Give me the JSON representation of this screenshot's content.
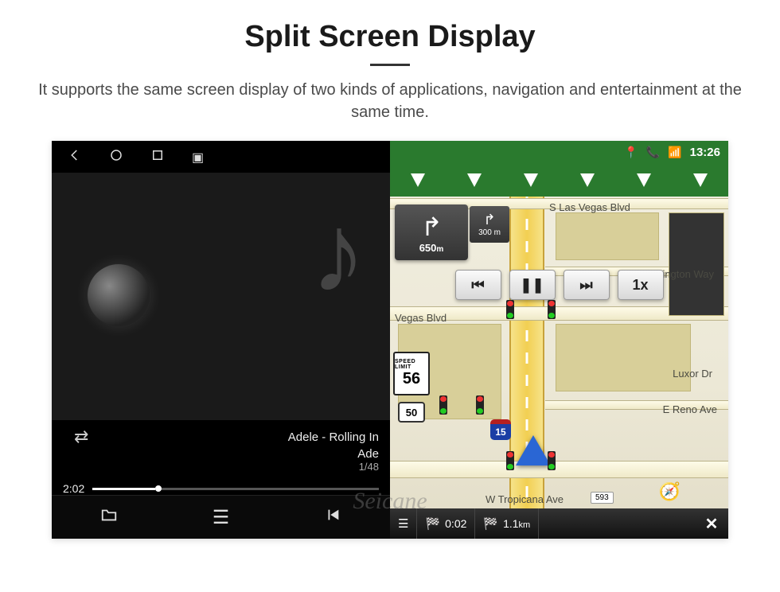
{
  "page": {
    "title": "Split Screen Display",
    "description": "It supports the same screen display of two kinds of applications, navigation and entertainment at the same time."
  },
  "statusbar": {
    "time": "13:26"
  },
  "music": {
    "track_title": "Adele - Rolling In",
    "artist": "Ade",
    "track_index": "1/48",
    "elapsed": "2:02"
  },
  "nav": {
    "turn_distance": "650",
    "turn_unit": "m",
    "next_turn_distance": "300",
    "next_turn_unit": "m",
    "speed_limit_label": "SPEED LIMIT",
    "speed_limit_value": "56",
    "route_number": "50",
    "interstate_number": "15",
    "speed_button": "1x",
    "streets": {
      "top": "S Las Vegas Blvd",
      "r1": "Duke Ellington Way",
      "r2": "Luxor Dr",
      "r3": "E Reno Ave",
      "l1": "Vegas Blvd",
      "bottom": "W Tropicana Ave",
      "bottom_badge": "593"
    },
    "bottom": {
      "eta": "0:02",
      "distance": "1.1",
      "distance_unit": "km"
    }
  },
  "watermark": "Seicane"
}
